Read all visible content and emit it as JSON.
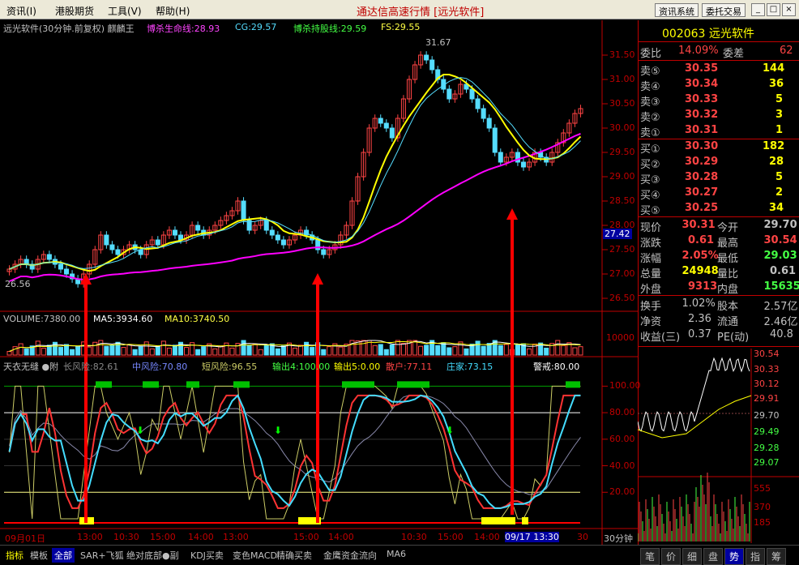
{
  "menu": {
    "items": [
      "资讯(I)",
      "港股期货",
      "工具(V)",
      "帮助(H)"
    ]
  },
  "window_title": "通达信高速行情 [远光软件]",
  "toolbar": {
    "btn1": "资讯系统",
    "btn2": "委托交易"
  },
  "main_header": {
    "stock": "远光软件(30分钟.前复权) 麒麟王",
    "line1_label": "博杀生命线:28.93",
    "line2_label": "CG:29.57",
    "line3_label": "博杀持股线:29.59",
    "line4_label": "FS:29.55"
  },
  "price_axis": {
    "labels": [
      "31.50",
      "31.00",
      "30.50",
      "30.00",
      "29.50",
      "29.00",
      "28.50",
      "28.00",
      "27.50",
      "27.00",
      "26.50"
    ],
    "current": "27.42"
  },
  "price_annotations": {
    "high": "31.67",
    "low": "26.56"
  },
  "volume_header": {
    "label": "VOLUME:7380.00",
    "ma5": "MA5:3934.60",
    "ma10": "MA10:3740.50",
    "axis": "10000"
  },
  "indicator_header": {
    "name": "天衣无缝 ●附",
    "long_risk": "长风险:82.61",
    "mid_risk": "中风险:70.80",
    "short_risk": "短风险:96.55",
    "out4": "输出4:100.00",
    "out5": "输出5:0.00",
    "retail": "散户:77.11",
    "dealer": "庄家:73.15",
    "warn": "警戒:80.00"
  },
  "indicator_axis": {
    "labels": [
      "100.00",
      "80.00",
      "60.00",
      "40.00",
      "20.00"
    ]
  },
  "time_axis": {
    "labels": [
      "09月01日",
      "13:00",
      "10:30",
      "15:00",
      "14:00",
      "13:00",
      "15:00",
      "14:00",
      "10:30",
      "15:00",
      "14:00",
      "09/17 13:30",
      "30"
    ],
    "period": "30分钟"
  },
  "chart_data": {
    "type": "candlestick",
    "x_period": "30分钟",
    "ylim": [
      26.3,
      31.8
    ],
    "price_axis_ticks": [
      26.5,
      27.0,
      27.5,
      28.0,
      28.5,
      29.0,
      29.5,
      30.0,
      30.5,
      31.0,
      31.5
    ],
    "close_series_approx": [
      27.1,
      27.2,
      27.3,
      27.2,
      27.1,
      27.3,
      27.4,
      27.3,
      27.2,
      27.1,
      27.0,
      26.9,
      26.8,
      27.0,
      27.2,
      27.5,
      27.8,
      27.6,
      27.5,
      27.4,
      27.5,
      27.6,
      27.5,
      27.4,
      27.6,
      27.7,
      27.6,
      27.8,
      27.9,
      27.8,
      27.7,
      27.8,
      28.0,
      27.9,
      27.8,
      27.9,
      28.0,
      28.1,
      28.2,
      28.3,
      28.5,
      28.1,
      27.9,
      28.0,
      28.1,
      27.9,
      27.8,
      27.7,
      27.6,
      27.7,
      27.8,
      27.9,
      27.8,
      27.7,
      27.5,
      27.4,
      27.5,
      27.6,
      27.8,
      28.0,
      28.5,
      29.0,
      29.5,
      30.0,
      30.2,
      30.1,
      30.0,
      29.8,
      30.2,
      30.6,
      31.0,
      31.3,
      31.5,
      31.4,
      31.2,
      31.0,
      30.8,
      30.6,
      30.7,
      30.9,
      30.8,
      30.6,
      30.4,
      30.2,
      30.0,
      29.5,
      29.3,
      29.4,
      29.5,
      29.3,
      29.2,
      29.3,
      29.5,
      29.4,
      29.3,
      29.5,
      29.7,
      29.9,
      30.1,
      30.3,
      30.4
    ],
    "series": [
      {
        "name": "博杀生命线",
        "color": "#ff00ff",
        "last": 28.93
      },
      {
        "name": "博杀持股线",
        "color": "#ffff00",
        "last": 29.59
      }
    ]
  },
  "quote": {
    "code_name": "002063 远光软件",
    "weibi_label": "委比",
    "weibi": "14.09%",
    "weicha_label": "委差",
    "weicha": "62",
    "sell": [
      {
        "label": "卖⑤",
        "price": "30.35",
        "vol": "144"
      },
      {
        "label": "卖④",
        "price": "30.34",
        "vol": "36"
      },
      {
        "label": "卖③",
        "price": "30.33",
        "vol": "5"
      },
      {
        "label": "卖②",
        "price": "30.32",
        "vol": "3"
      },
      {
        "label": "卖①",
        "price": "30.31",
        "vol": "1"
      }
    ],
    "buy": [
      {
        "label": "买①",
        "price": "30.30",
        "vol": "182"
      },
      {
        "label": "买②",
        "price": "30.29",
        "vol": "28"
      },
      {
        "label": "买③",
        "price": "30.28",
        "vol": "5"
      },
      {
        "label": "买④",
        "price": "30.27",
        "vol": "2"
      },
      {
        "label": "买⑤",
        "price": "30.25",
        "vol": "34"
      }
    ],
    "stats": [
      {
        "l1": "现价",
        "v1": "30.31",
        "l2": "今开",
        "v2": "29.70"
      },
      {
        "l1": "涨跌",
        "v1": "0.61",
        "l2": "最高",
        "v2": "30.54"
      },
      {
        "l1": "涨幅",
        "v1": "2.05%",
        "l2": "最低",
        "v2": "29.03"
      },
      {
        "l1": "总量",
        "v1": "24948",
        "l2": "量比",
        "v2": "0.61"
      },
      {
        "l1": "外盘",
        "v1": "9313",
        "l2": "内盘",
        "v2": "15635"
      }
    ],
    "stats2": [
      {
        "l1": "换手",
        "v1": "1.02%",
        "l2": "股本",
        "v2": "2.57亿"
      },
      {
        "l1": "净资",
        "v1": "2.36",
        "l2": "流通",
        "v2": "2.46亿"
      },
      {
        "l1": "收益(三)",
        "v1": "0.37",
        "l2": "PE(动)",
        "v2": "40.8"
      }
    ]
  },
  "mini_chart": {
    "labels": [
      "30.54",
      "30.33",
      "30.12",
      "29.91",
      "29.70",
      "29.49",
      "29.28",
      "29.07",
      "555",
      "370",
      "185"
    ]
  },
  "bottom_tabs": [
    "指标",
    "模板",
    "全部",
    "SAR+飞狐",
    "绝对底部●副",
    "KDJ买卖",
    "变色MACD",
    "精确买卖",
    "金鹰资金流向",
    "MA6"
  ],
  "right_tabs": [
    "笔",
    "价",
    "细",
    "盘",
    "势",
    "指",
    "筹"
  ]
}
